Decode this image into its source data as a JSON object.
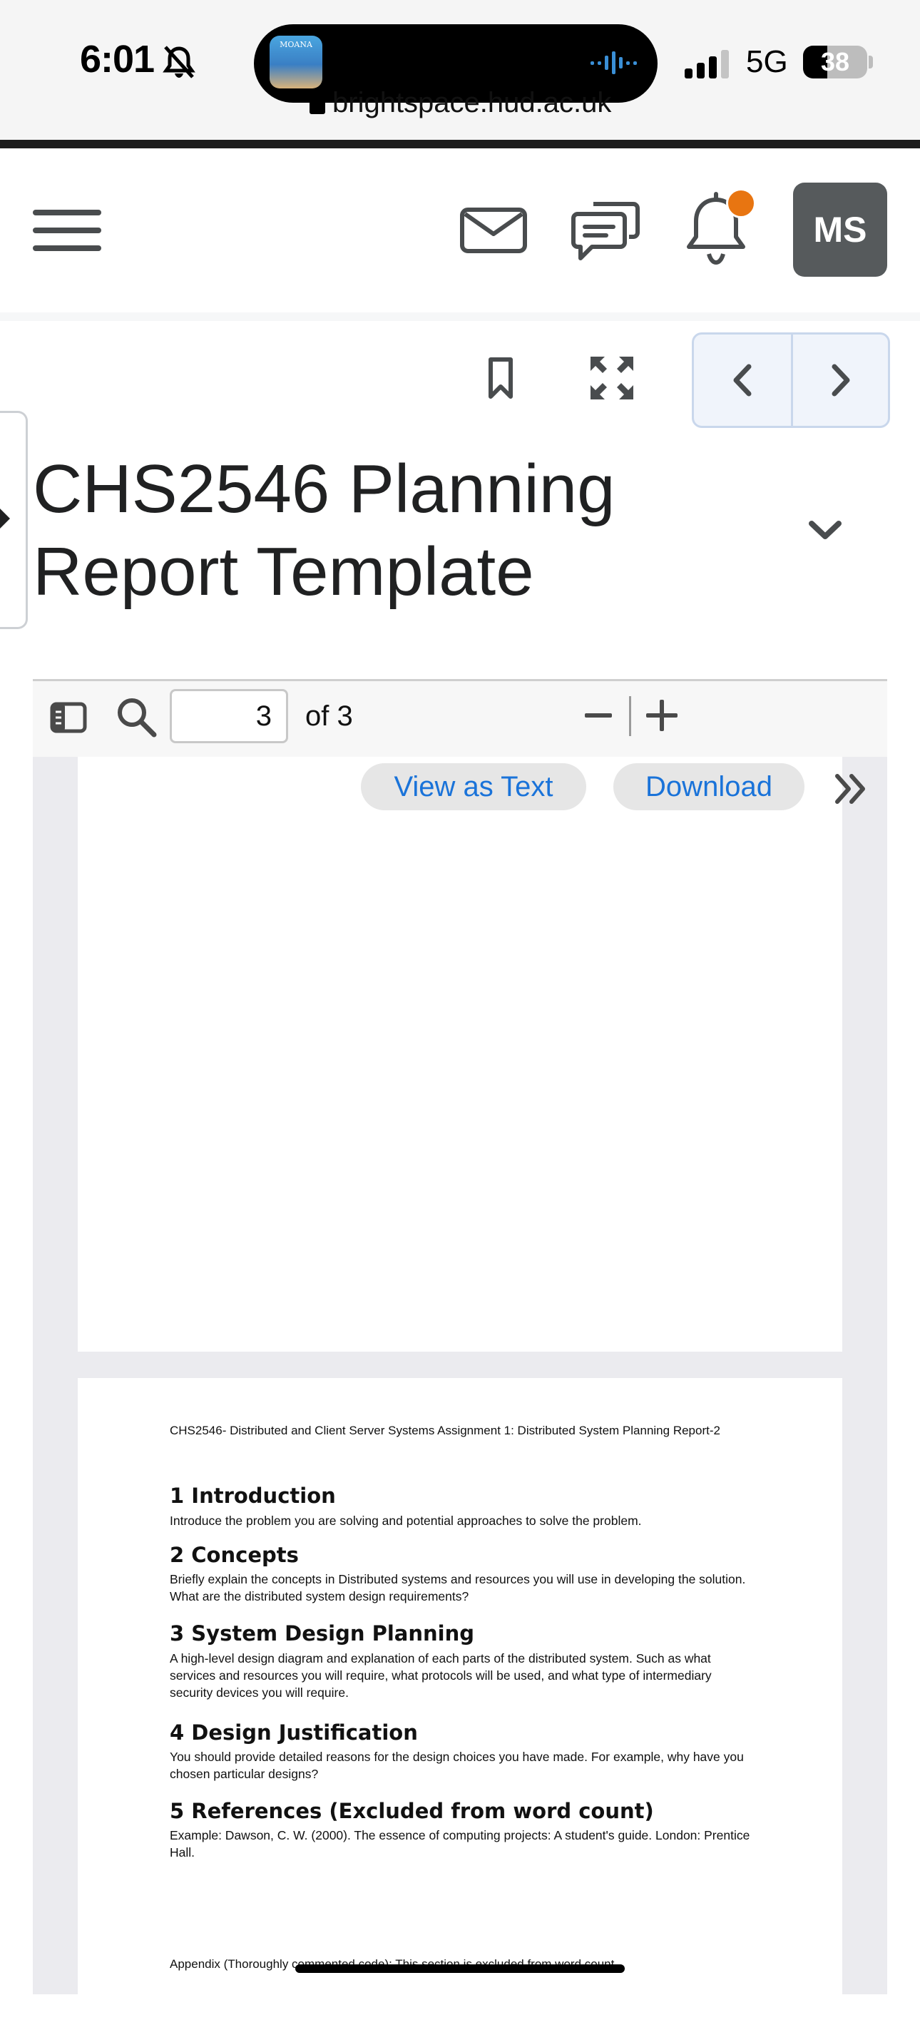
{
  "status_bar": {
    "time": "6:01",
    "network": "5G",
    "battery": "38",
    "battery_level": 0.38,
    "url": "brightspace.hud.ac.uk",
    "now_playing_art_label": "MOANA"
  },
  "nav": {
    "avatar_initials": "MS",
    "notification_dot_color": "#e87511"
  },
  "content": {
    "title": "CHS2546 Planning Report Template"
  },
  "viewer": {
    "page_current": "3",
    "page_of": "of 3",
    "view_as_text": "View as Text",
    "download": "Download"
  },
  "document": {
    "header": "CHS2546- Distributed and Client Server Systems Assignment 1: Distributed System Planning Report-2",
    "sections": [
      {
        "heading": "1  Introduction",
        "body": "Introduce the problem you are solving and potential approaches to solve the problem."
      },
      {
        "heading": "2  Concepts",
        "body": "Briefly explain the concepts in Distributed systems and resources you will use in developing the solution. What are the distributed system design requirements?"
      },
      {
        "heading": "3  System Design Planning",
        "body": "A high-level design diagram and explanation of each parts of the distributed system. Such as what services and resources you will require, what protocols will be used, and what type of intermediary security devices you will require."
      },
      {
        "heading": "4  Design Justification",
        "body": "You should provide detailed reasons for the design choices you have made. For example, why have you chosen particular designs?"
      },
      {
        "heading": "5  References (Excluded from word count)",
        "body": "Example: Dawson, C. W. (2000). The essence of computing projects: A student's guide. London: Prentice Hall."
      }
    ],
    "appendix": "Appendix (Thoroughly commented code): This section is excluded from word count."
  }
}
